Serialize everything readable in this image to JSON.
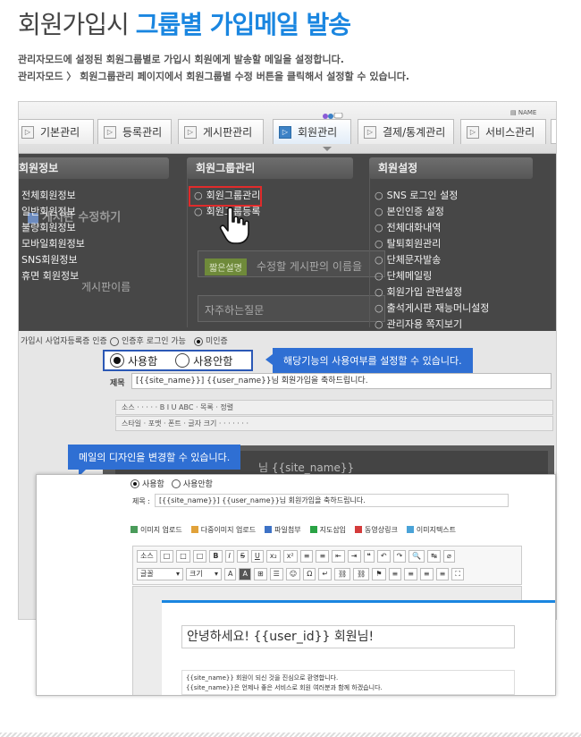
{
  "header": {
    "title_prefix": "회원가입시",
    "title_accent": "그룹별 가입메일 발송",
    "desc_line1": "관리자모드에 설정된 회원그룹별로 가입시 회원에게 발송할 메일을 설정합니다.",
    "desc_line2": "관리자모드 〉 회원그룹관리 페이지에서 회원그룹별 수정 버튼을 클릭해서 설정할 수 있습니다."
  },
  "nav": {
    "tabs": [
      {
        "label": "기본관리"
      },
      {
        "label": "등록관리"
      },
      {
        "label": "게시판관리"
      },
      {
        "label": "회원관리"
      },
      {
        "label": "결제/통계관리"
      },
      {
        "label": "서비스관리"
      }
    ],
    "name_badge": "NAME"
  },
  "dropdown": {
    "col1": {
      "heading": "회원정보",
      "items": [
        "전체회원정보",
        "일반회원정보",
        "불량회원정보",
        "모바일회원정보",
        "SNS회원정보",
        "휴면 회원정보"
      ]
    },
    "col2": {
      "heading": "회원그룹관리",
      "items": [
        "회원그룹관리",
        "회원그룹등록"
      ]
    },
    "col3": {
      "heading": "회원설정",
      "items": [
        "SNS 로그인 설정",
        "본인인증 설정",
        "전체대화내역",
        "탈퇴회원관리",
        "단체문자발송",
        "단체메일링",
        "회원가입 관련설정",
        "출석게시판 재능머니설정",
        "관리자용 쪽지보기"
      ]
    },
    "behind": {
      "edit_title": "게시판 수정하기",
      "board_name": "게시판이름",
      "short_btn": "짧은설명",
      "hint": "수정할 게시판의 이름을",
      "faq": "자주하는질문"
    }
  },
  "form": {
    "small_row_label": "가입시 사업자등록증 인증",
    "small_opt1": "인증후 로그인 가능",
    "small_opt2": "미인증",
    "use_label": "사용함",
    "nouse_label": "사용안함",
    "callout_use": "해당기능의 사용여부를 설정할 수 있습니다.",
    "subject_label": "제목",
    "subject_value": "[{{site_name}}] {{user_name}}님 회원가입을 축하드립니다.",
    "toolbar_row1": "소스 · · · · · B I U ABC · 목록 · 정렬",
    "toolbar_row2": "스타일 · 포맷 · 폰트 · 글자 크기 · · · · · · ·",
    "dark_editor_text": "님 {{site_name}}",
    "callout_design": "메일의 디자인을 변경할 수 있습니다."
  },
  "panel": {
    "use_label": "사용함",
    "nouse_label": "사용안함",
    "subject_label": "제목 :",
    "subject_value": "[{{site_name}}] {{user_name}}님 회원가입을 축하드립니다.",
    "upload_tools": [
      "이미지 업로드",
      "다중이미지 업로드",
      "파일첨부",
      "지도삽입",
      "동영상링크",
      "이미지텍스트"
    ],
    "tb_row1": [
      "소스",
      "□",
      "□",
      "□",
      "B",
      "I",
      "S",
      "U",
      "x₂",
      "x²",
      "≡",
      "≡",
      "⇤",
      "⇥",
      "❝",
      "↶",
      "↷",
      "🔍",
      "↹",
      "⌀"
    ],
    "tb_row2": [
      "글꼴",
      "크기",
      "A",
      "A",
      "⊞",
      "☰",
      "☺",
      "Ω",
      "↵",
      "⛓",
      "⛓",
      "⚑",
      "≡",
      "≡",
      "≡",
      "≡",
      "⛶"
    ],
    "greeting": "안녕하세요! {{user_id}} 회원님!",
    "welcome_line1": "{{site_name}} 회원이 되신 것을 진심으로 환영합니다.",
    "welcome_line2": "{{site_name}}은 언제나 좋은 서비스로 회원 여러분과 함께 하겠습니다."
  },
  "colors": {
    "accent": "#1a86e0",
    "callout": "#2f6fd3",
    "highlight_red": "#e02b2b",
    "dropdown_bg": "#474747"
  }
}
